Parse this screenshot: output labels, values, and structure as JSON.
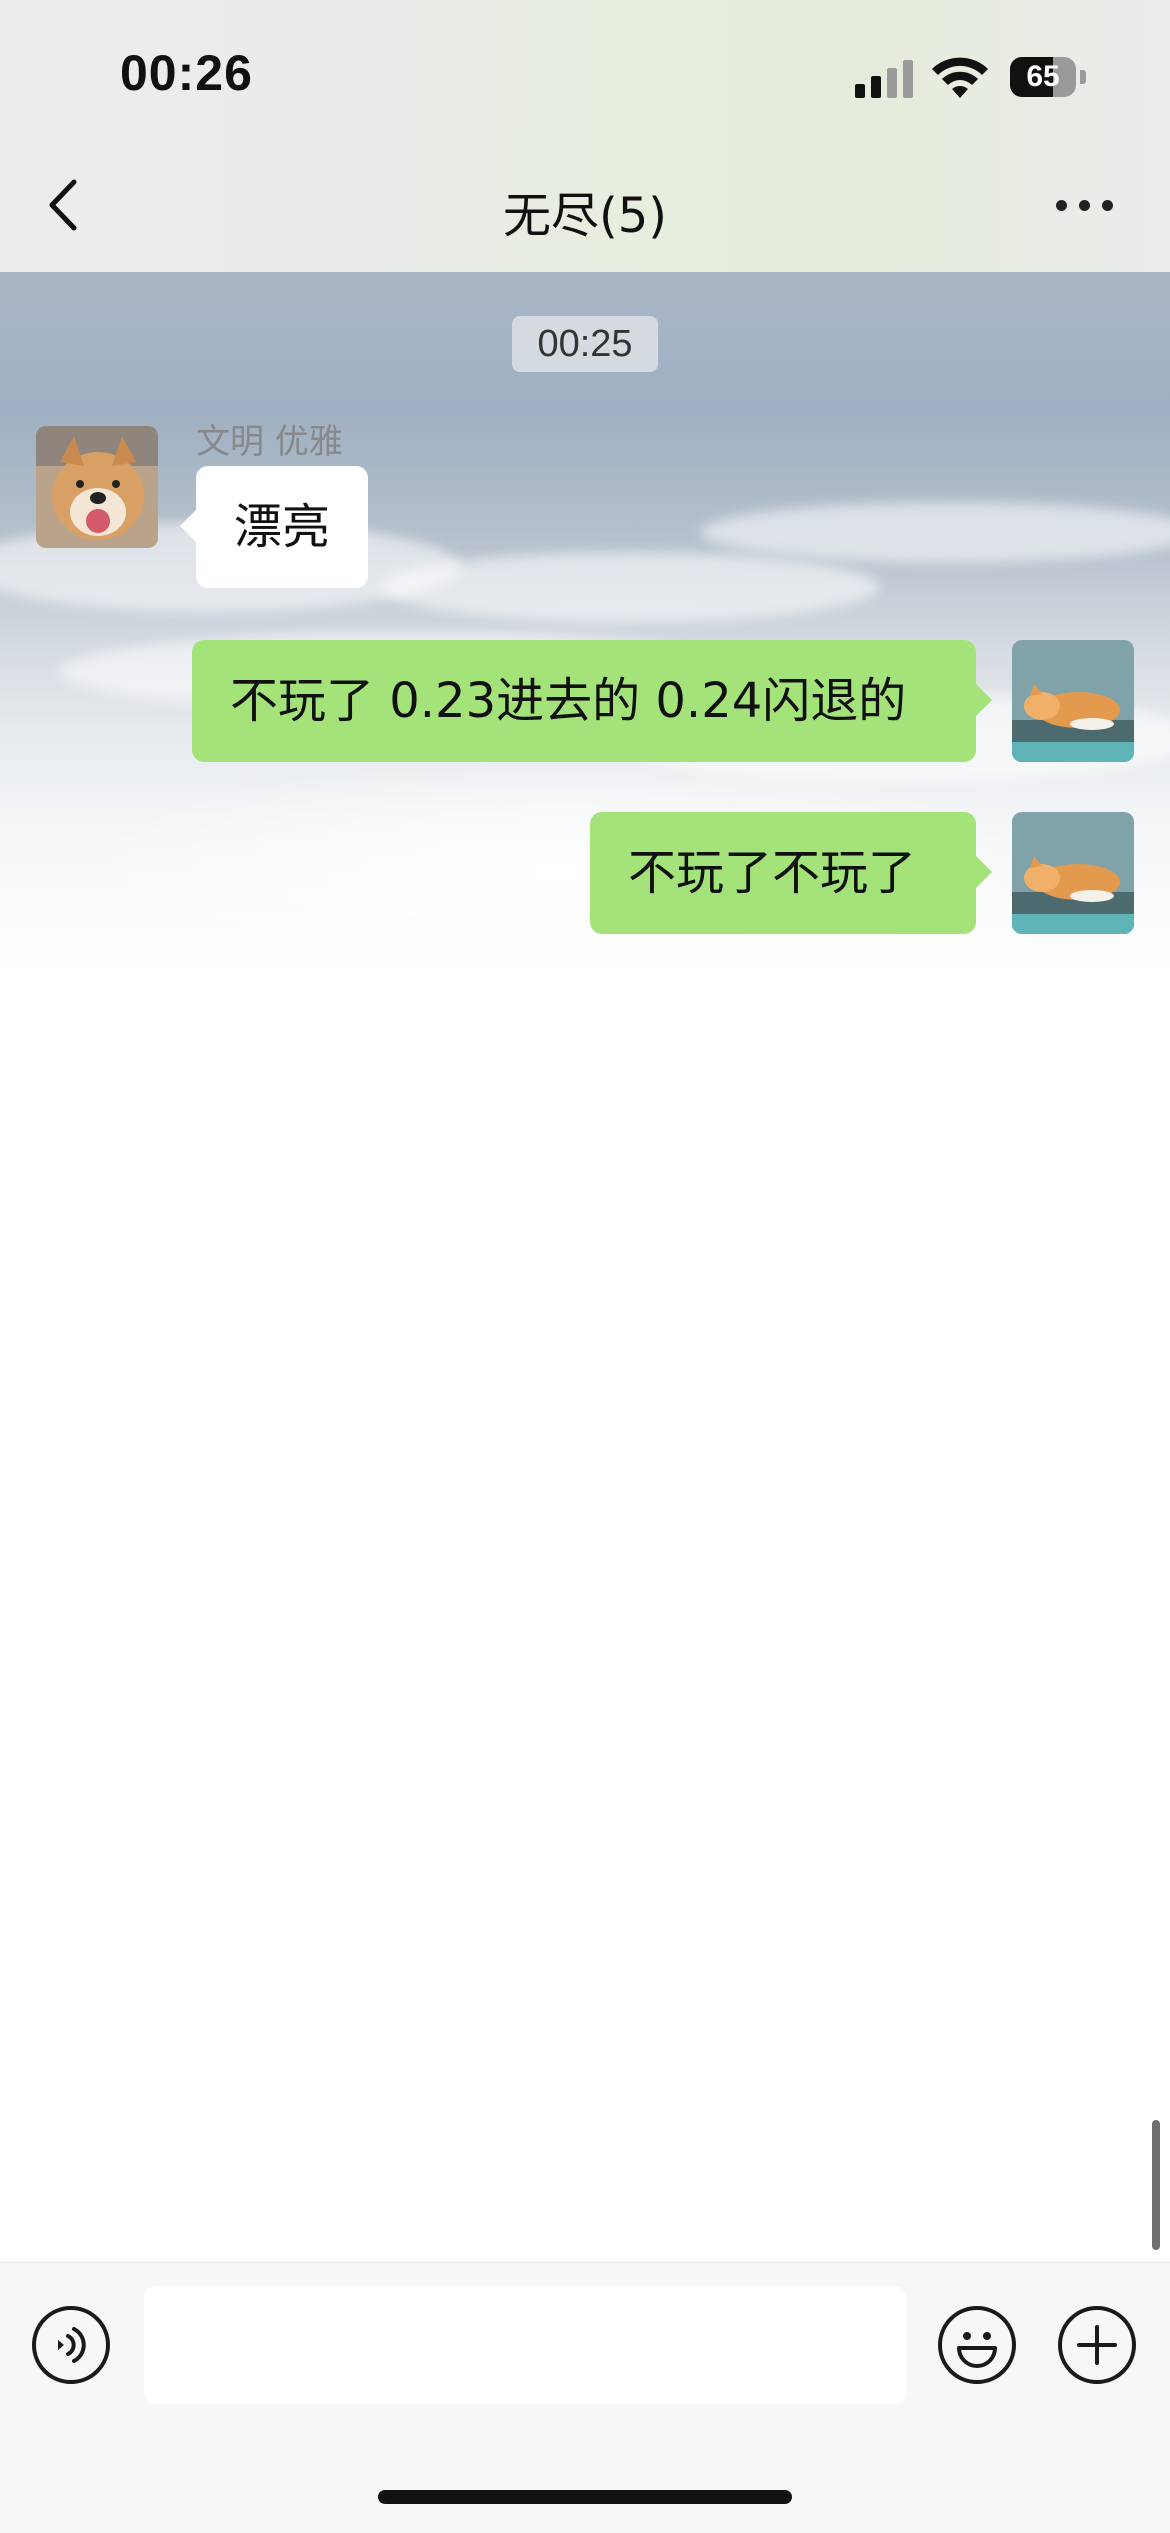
{
  "status_bar": {
    "time": "00:26",
    "battery_level": "65",
    "signal_icon": "cellular-signal-icon",
    "wifi_icon": "wifi-icon"
  },
  "header": {
    "title": "无尽(5)",
    "back_icon": "chevron-left-icon",
    "more_icon": "more-dots-icon"
  },
  "chat": {
    "timestamp": "00:25",
    "messages": [
      {
        "direction": "incoming",
        "sender": "文明 优雅",
        "text": "漂亮",
        "avatar": "shiba-dog-avatar"
      },
      {
        "direction": "outgoing",
        "text": "不玩了 0.23进去的 0.24闪退的",
        "avatar": "sleeping-cat-avatar"
      },
      {
        "direction": "outgoing",
        "text": "不玩了不玩了",
        "avatar": "sleeping-cat-avatar"
      }
    ]
  },
  "input_bar": {
    "input_value": "",
    "voice_icon": "voice-icon",
    "emoji_icon": "emoji-icon",
    "plus_icon": "plus-icon"
  },
  "colors": {
    "outgoing_bubble": "#a4e37a",
    "incoming_bubble": "#ffffff",
    "input_bar_bg": "#f7f7f7"
  }
}
